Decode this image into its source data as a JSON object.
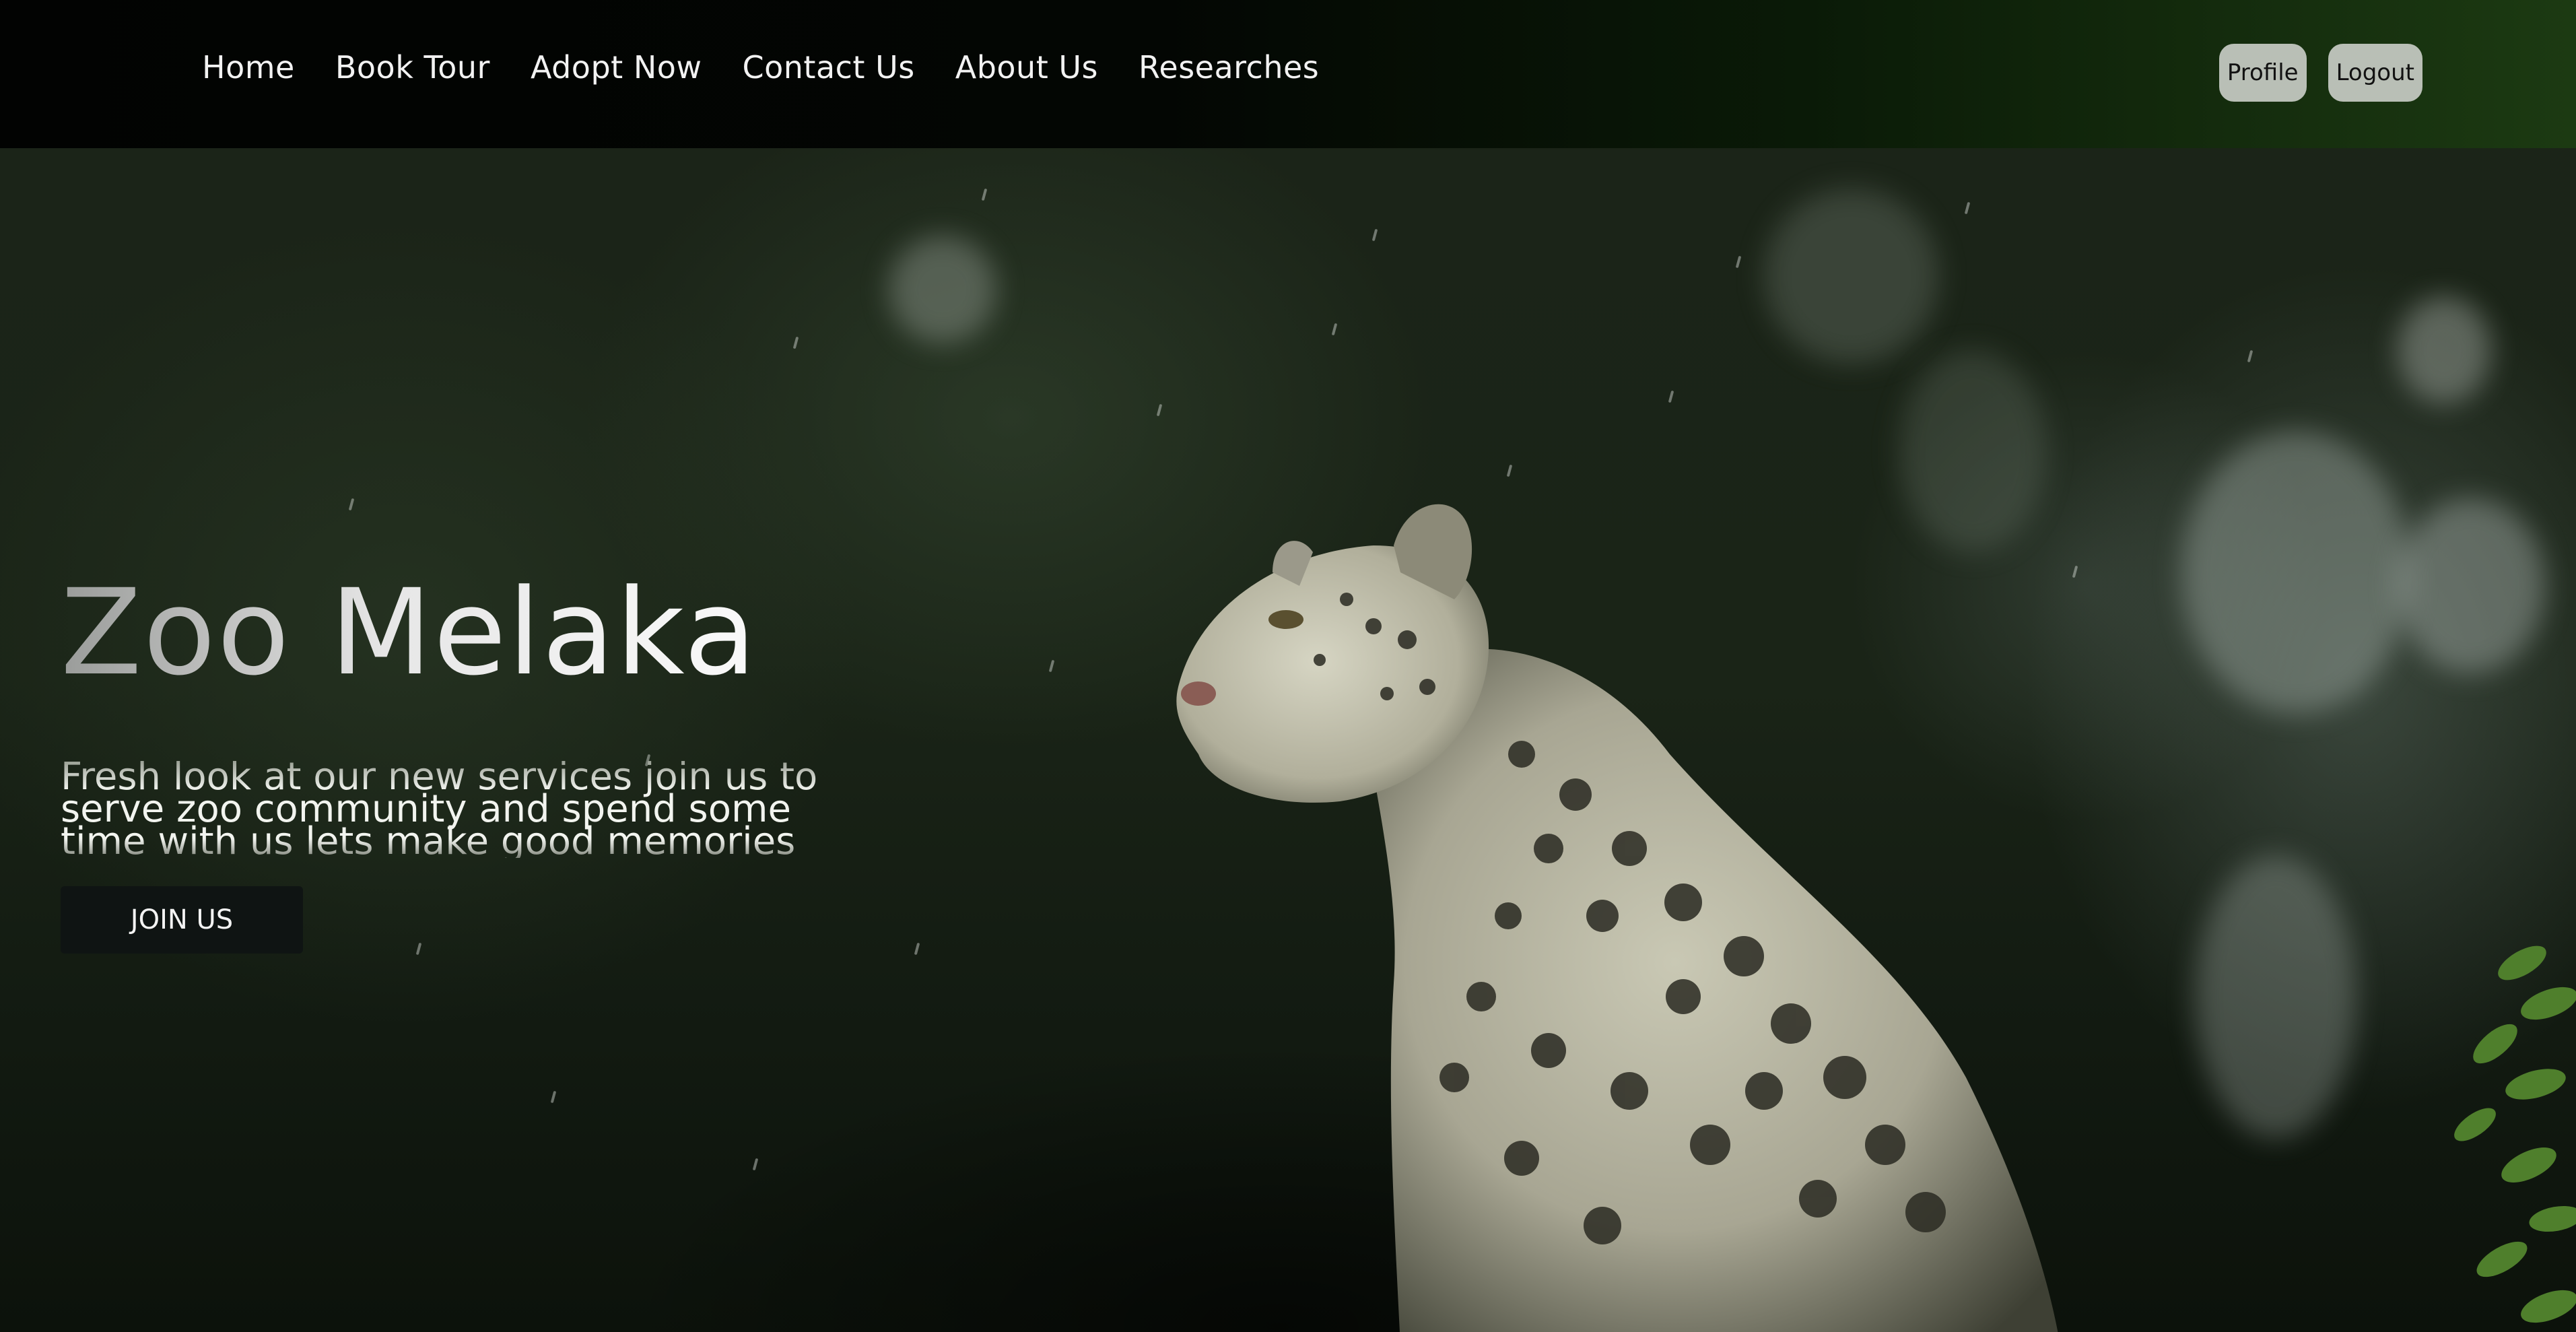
{
  "nav": {
    "links": [
      {
        "label": "Home"
      },
      {
        "label": "Book Tour"
      },
      {
        "label": "Adopt Now"
      },
      {
        "label": "Contact Us"
      },
      {
        "label": "About Us"
      },
      {
        "label": "Researches"
      }
    ],
    "profile_label": "Profile",
    "logout_label": "Logout"
  },
  "hero": {
    "title": "Zoo Melaka",
    "description": "Fresh look at our new services join us to serve zoo community and spend some time with us lets make good memories",
    "cta_label": "JOIN US",
    "image_subject": "snow-leopard"
  },
  "colors": {
    "nav_gradient_end": "#1c3a12",
    "button_bg": "#b9bfb6",
    "cta_bg": "#0f1413"
  }
}
